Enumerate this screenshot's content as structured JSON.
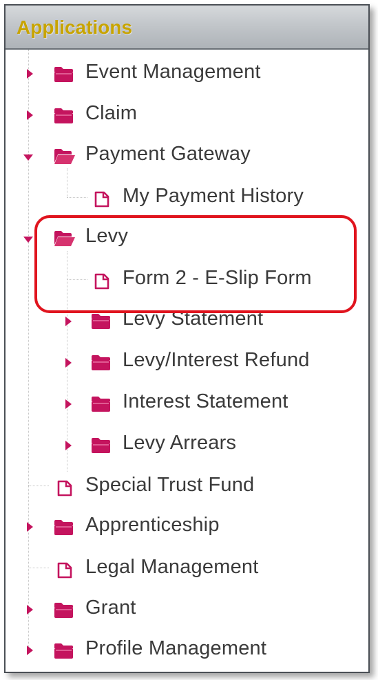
{
  "header": {
    "title": "Applications",
    "title_color": "#c8a400"
  },
  "accent_color": "#c4145e",
  "highlight_color": "#e0141e",
  "tree": {
    "event_management": {
      "label": "Event Management",
      "icon": "folder-closed-icon",
      "state": "collapsed"
    },
    "claim": {
      "label": "Claim",
      "icon": "folder-closed-icon",
      "state": "collapsed"
    },
    "payment_gateway": {
      "label": "Payment Gateway",
      "icon": "folder-open-icon",
      "state": "expanded"
    },
    "my_payment_history": {
      "label": "My Payment History",
      "icon": "page-icon"
    },
    "levy": {
      "label": "Levy",
      "icon": "folder-open-icon",
      "state": "expanded"
    },
    "form2_eslip": {
      "label": "Form 2 - E-Slip Form",
      "icon": "page-icon"
    },
    "levy_statement": {
      "label": "Levy Statement",
      "icon": "folder-closed-icon",
      "state": "collapsed"
    },
    "levy_interest_refund": {
      "label": "Levy/Interest Refund",
      "icon": "folder-closed-icon",
      "state": "collapsed"
    },
    "interest_statement": {
      "label": "Interest Statement",
      "icon": "folder-closed-icon",
      "state": "collapsed"
    },
    "levy_arrears": {
      "label": "Levy Arrears",
      "icon": "folder-closed-icon",
      "state": "collapsed"
    },
    "special_trust_fund": {
      "label": "Special Trust Fund",
      "icon": "page-icon"
    },
    "apprenticeship": {
      "label": "Apprenticeship",
      "icon": "folder-closed-icon",
      "state": "collapsed"
    },
    "legal_management": {
      "label": "Legal Management",
      "icon": "page-icon"
    },
    "grant": {
      "label": "Grant",
      "icon": "folder-closed-icon",
      "state": "collapsed"
    },
    "profile_management": {
      "label": "Profile Management",
      "icon": "folder-closed-icon",
      "state": "collapsed"
    }
  }
}
